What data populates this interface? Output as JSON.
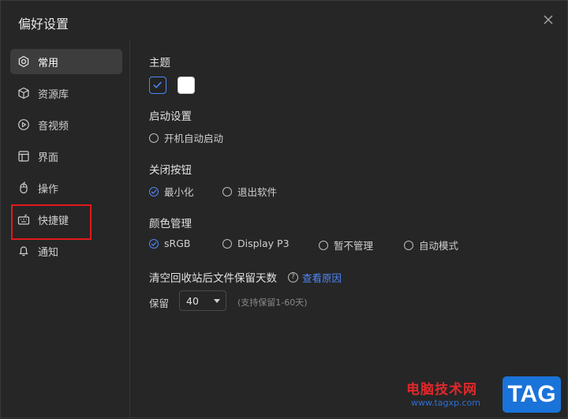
{
  "window": {
    "title": "偏好设置"
  },
  "sidebar": {
    "items": [
      {
        "label": "常用",
        "icon": "gear-icon",
        "active": true
      },
      {
        "label": "资源库",
        "icon": "cube-icon",
        "active": false
      },
      {
        "label": "音视频",
        "icon": "play-circle-icon",
        "active": false
      },
      {
        "label": "界面",
        "icon": "layout-icon",
        "active": false
      },
      {
        "label": "操作",
        "icon": "mouse-icon",
        "active": false
      },
      {
        "label": "快捷键",
        "icon": "keyboard-icon",
        "active": false
      },
      {
        "label": "通知",
        "icon": "bell-icon",
        "active": false
      }
    ]
  },
  "settings": {
    "theme": {
      "title": "主题",
      "selected": "dark"
    },
    "startup": {
      "title": "启动设置",
      "option": "开机自动启动",
      "checked": false
    },
    "close_button": {
      "title": "关闭按钮",
      "options": [
        "最小化",
        "退出软件"
      ],
      "selected": 0
    },
    "color": {
      "title": "颜色管理",
      "options": [
        "sRGB",
        "Display P3",
        "暂不管理",
        "自动模式"
      ],
      "selected": 0
    },
    "trash": {
      "title": "清空回收站后文件保留天数",
      "help_link": "查看原因",
      "keep_label": "保留",
      "value": "40",
      "hint": "(支持保留1-60天)"
    }
  },
  "watermark": {
    "text": "电脑技术网",
    "url": "www.tagxp.com",
    "tag": "TAG"
  },
  "colors": {
    "accent": "#4f86f7",
    "highlight_border": "#e2191b",
    "background": "#262626"
  }
}
